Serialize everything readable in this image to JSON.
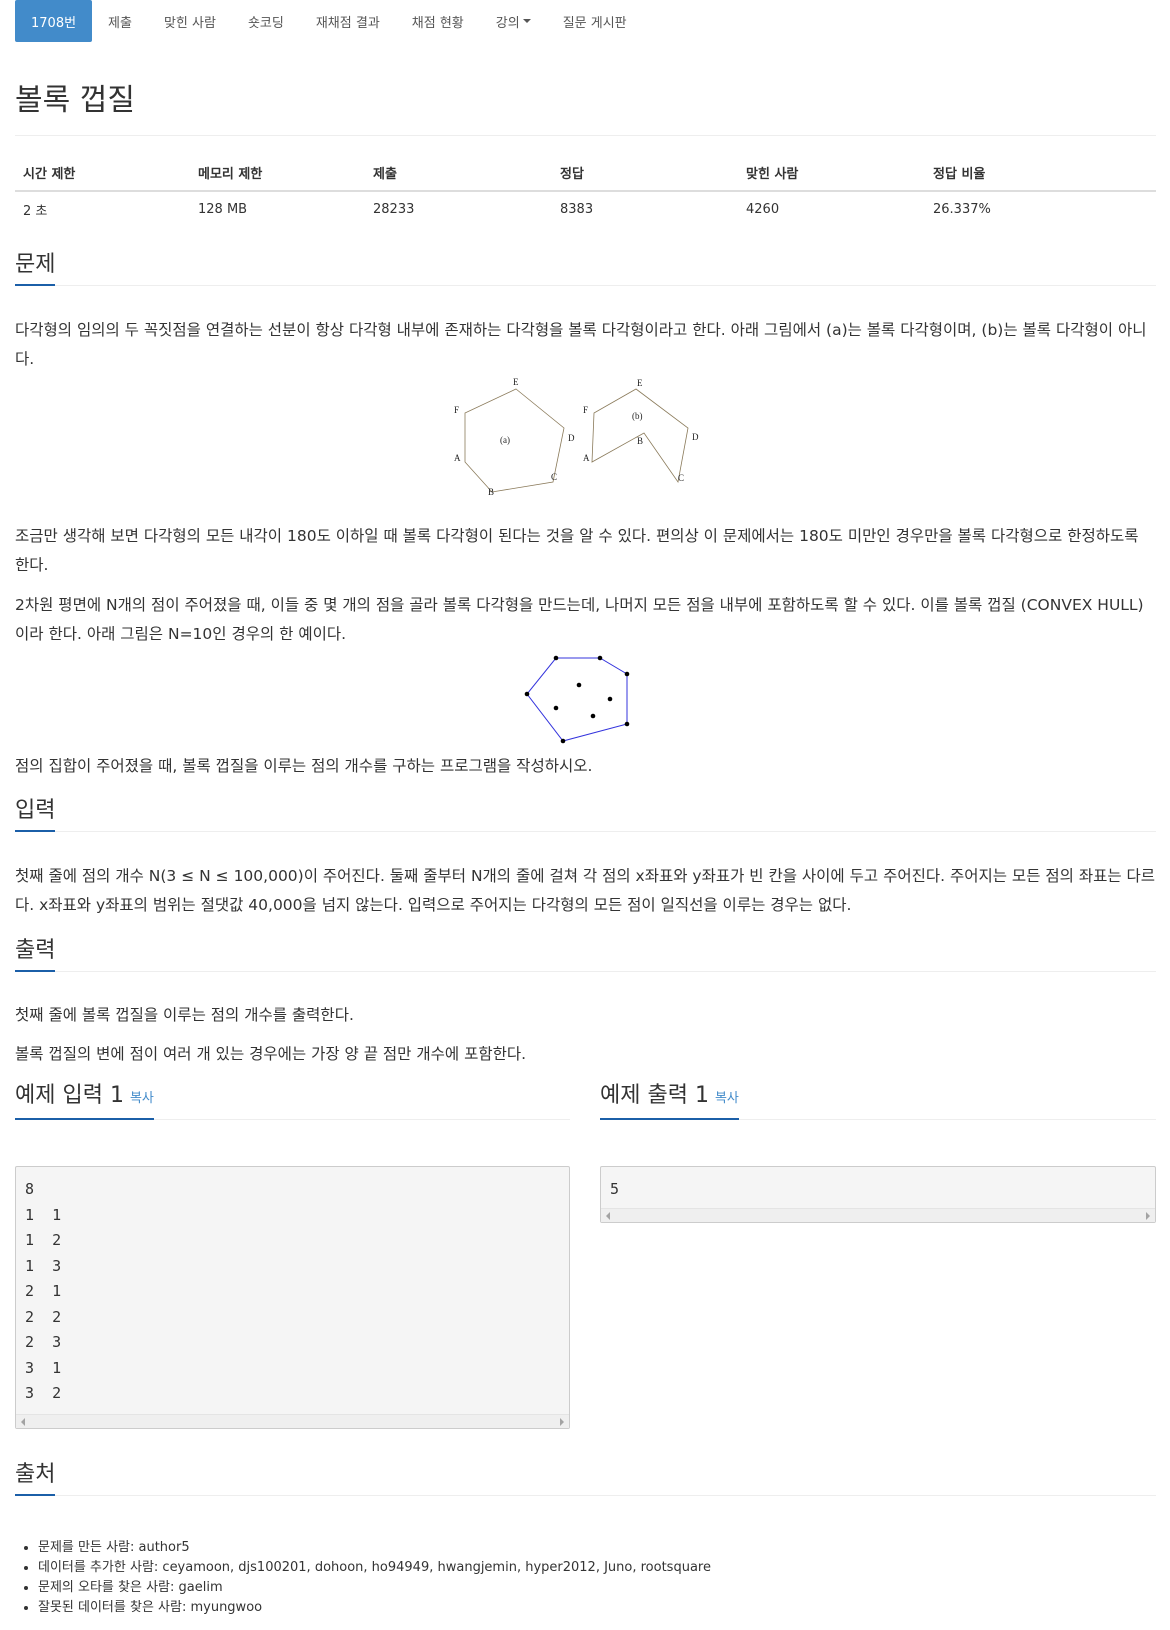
{
  "nav": {
    "tabs": [
      "1708번",
      "제출",
      "맞힌 사람",
      "숏코딩",
      "재채점 결과",
      "채점 현황",
      "강의",
      "질문 게시판"
    ]
  },
  "problem": {
    "title": "볼록 껍질",
    "stats_headers": [
      "시간 제한",
      "메모리 제한",
      "제출",
      "정답",
      "맞힌 사람",
      "정답 비율"
    ],
    "stats_values": [
      "2 초",
      "128 MB",
      "28233",
      "8383",
      "4260",
      "26.337%"
    ]
  },
  "sections": {
    "problem_heading": "문제",
    "problem_p1": "다각형의 임의의 두 꼭짓점을 연결하는 선분이 항상 다각형 내부에 존재하는 다각형을 볼록 다각형이라고 한다. 아래 그림에서 (a)는 볼록 다각형이며, (b)는 볼록 다각형이 아니다.",
    "problem_p2": "조금만 생각해 보면 다각형의 모든 내각이 180도 이하일 때 볼록 다각형이 된다는 것을 알 수 있다. 편의상 이 문제에서는 180도 미만인 경우만을 볼록 다각형으로 한정하도록 한다.",
    "problem_p3": "2차원 평면에 N개의 점이 주어졌을 때, 이들 중 몇 개의 점을 골라 볼록 다각형을 만드는데, 나머지 모든 점을 내부에 포함하도록 할 수 있다. 이를 볼록 껍질 (CONVEX HULL) 이라 한다. 아래 그림은 N=10인 경우의 한 예이다.",
    "problem_p4": "점의 집합이 주어졌을 때, 볼록 껍질을 이루는 점의 개수를 구하는 프로그램을 작성하시오.",
    "input_heading": "입력",
    "input_p": "첫째 줄에 점의 개수 N(3 ≤ N ≤ 100,000)이 주어진다. 둘째 줄부터 N개의 줄에 걸쳐 각 점의 x좌표와 y좌표가 빈 칸을 사이에 두고 주어진다. 주어지는 모든 점의 좌표는 다르다. x좌표와 y좌표의 범위는 절댓값 40,000을 넘지 않는다. 입력으로 주어지는 다각형의 모든 점이 일직선을 이루는 경우는 없다.",
    "output_heading": "출력",
    "output_p1": "첫째 줄에 볼록 껍질을 이루는 점의 개수를 출력한다.",
    "output_p2": "볼록 껍질의 변에 점이 여러 개 있는 경우에는 가장 양 끝 점만 개수에 포함한다.",
    "sample_in_heading": "예제 입력 1",
    "sample_out_heading": "예제 출력 1",
    "copy_label": "복사",
    "source_heading": "출처"
  },
  "figure_a": {
    "labels": [
      "E",
      "F",
      "D",
      "(a)",
      "A",
      "C",
      "B"
    ]
  },
  "figure_b": {
    "labels": [
      "E",
      "F",
      "(b)",
      "B",
      "D",
      "A",
      "C"
    ]
  },
  "sample_input": [
    "8",
    "1  1",
    "1  2",
    "1  3",
    "2  1",
    "2  2",
    "2  3",
    "3  1",
    "3  2"
  ],
  "sample_output": [
    "5"
  ],
  "credits": [
    "문제를 만든 사람: author5",
    "데이터를 추가한 사람: ceyamoon, djs100201, dohoon, ho94949, hwangjemin, hyper2012, Juno, rootsquare",
    "문제의 오타를 찾은 사람: gaelim",
    "잘못된 데이터를 찾은 사람: myungwoo"
  ],
  "colors": {
    "accent": "#428bca",
    "heading_underline": "#1b5fa8",
    "hull_line": "#3333dd"
  }
}
